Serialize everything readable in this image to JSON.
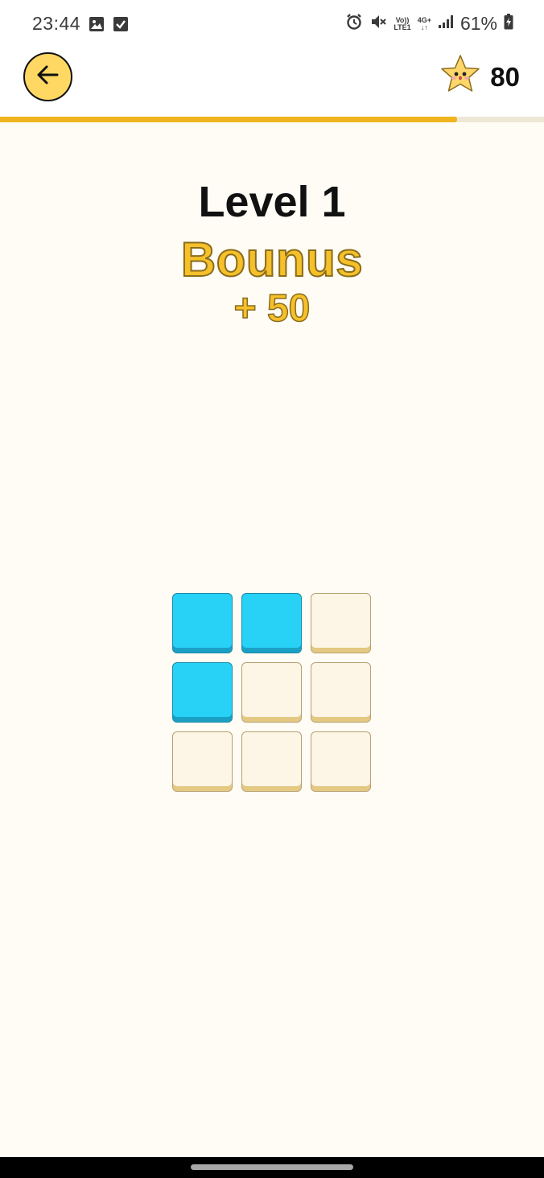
{
  "status_bar": {
    "time": "23:44",
    "network_top": "Vo))",
    "network_bottom": "LTE1",
    "network_type": "4G+",
    "battery": "61%",
    "icons": [
      "image-icon",
      "check-icon",
      "alarm-icon",
      "mute-icon",
      "signal-icon",
      "battery-icon"
    ]
  },
  "header": {
    "back_icon": "arrow-left-icon",
    "star_icon": "star-mascot-icon",
    "score": "80"
  },
  "progress": {
    "fraction": 0.84
  },
  "level": {
    "title": "Level 1",
    "bonus_label": "Bounus",
    "bonus_amount": "+ 50"
  },
  "board": {
    "rows": 3,
    "cols": 3,
    "cells": [
      [
        true,
        true,
        false
      ],
      [
        true,
        false,
        false
      ],
      [
        false,
        false,
        false
      ]
    ]
  },
  "colors": {
    "accent": "#f0b41f",
    "tile_on": "#27d2f6",
    "tile_off": "#fdf5e6",
    "background": "#fffcf5"
  }
}
